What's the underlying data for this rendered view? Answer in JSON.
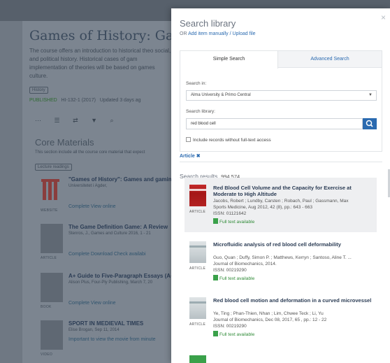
{
  "background": {
    "course_title": "Games of History: Game",
    "description": "The course offers an introduction to historical theo social, and political history. Historical cases of gam implementation of theories will be based on games culture.",
    "tag": "History",
    "meta": {
      "status": "PUBLISHED",
      "code": "HI-132-1 (2017)",
      "updated": "Updated 3 days ag"
    },
    "section_title": "Core Materials",
    "section_desc": "This section include all the course core material that expect",
    "section_tag": "Lecture readings",
    "items": [
      {
        "type": "WEBSITE",
        "title": "\"Games of History\": Games and gaming",
        "sub": "Universitetet i Agder,",
        "actions": "Complete   View online"
      },
      {
        "type": "ARTICLE",
        "title": "The Game Definition Game: A Review",
        "sub": "Stenros, J., Games and Culture 2016, 1 - 21",
        "actions": "Complete   Download   Check availabi"
      },
      {
        "type": "BOOK",
        "title": "A+ Guide to Five-Paragraph Essays (A+",
        "sub": "Alison Plus, Four-Ply Publishing, March 7, 20",
        "actions": "Complete   View online"
      },
      {
        "type": "VIDEO",
        "title": "SPORT IN MEDIEVAL TIMES",
        "sub": "Elise Brogan, Sep 11, 2014",
        "actions": "Important to view the movie from minute"
      }
    ]
  },
  "modal": {
    "title": "Search library",
    "sub_prefix": "OR ",
    "sub_link": "Add item manually / Upload file",
    "close_icon": "×",
    "tabs": {
      "simple": "Simple Search",
      "advanced": "Advanced Search"
    },
    "search_in_label": "Search in:",
    "search_in_value": "Alma University & Primo Central",
    "search_library_label": "Search library:",
    "query": "red blood cell",
    "checkbox_label": "Include records without full-text access",
    "filter": "Article ✖",
    "results_label": "Search results",
    "results_count": "994,574",
    "results": [
      {
        "type": "ARTICLE",
        "title": "Red Blood Cell Volume and the Capacity for Exercise at Moderate to High Altitude",
        "authors": "Jacobs, Robert ; Lundby, Carsten ; Robach, Paul ; Gassmann, Max",
        "source": "Sports Medicine, Aug 2012, 42 (8), pp.: 643 - 663",
        "issn": "ISSN: 01121642",
        "fulltext": "Full text available"
      },
      {
        "type": "ARTICLE",
        "title": "Microfluidic analysis of red blood cell deformability",
        "authors": "Guo, Quan ; Duffy, Simon P. ; Matthews, Kerryn ; Santoso, Aline T. ...",
        "source": "Journal of Biomechanics, 2014.",
        "issn": "ISSN: 00219290",
        "fulltext": "Full text available"
      },
      {
        "type": "ARTICLE",
        "title": "Red blood cell motion and deformation in a curved microvessel",
        "authors": "Ye, Ting ; Phan-Thien, Nhan ; Lim, Chwee Teck ; Li, Yu",
        "source": "Journal of Biomechanics, Dec 08, 2017, 65 , pp.: 12 - 22",
        "issn": "ISSN: 00219290",
        "fulltext": "Full text available"
      }
    ]
  },
  "colors": {
    "accent": "#2a6ab0",
    "fulltext": "#2e8a36",
    "overlay": "#6f7883"
  }
}
